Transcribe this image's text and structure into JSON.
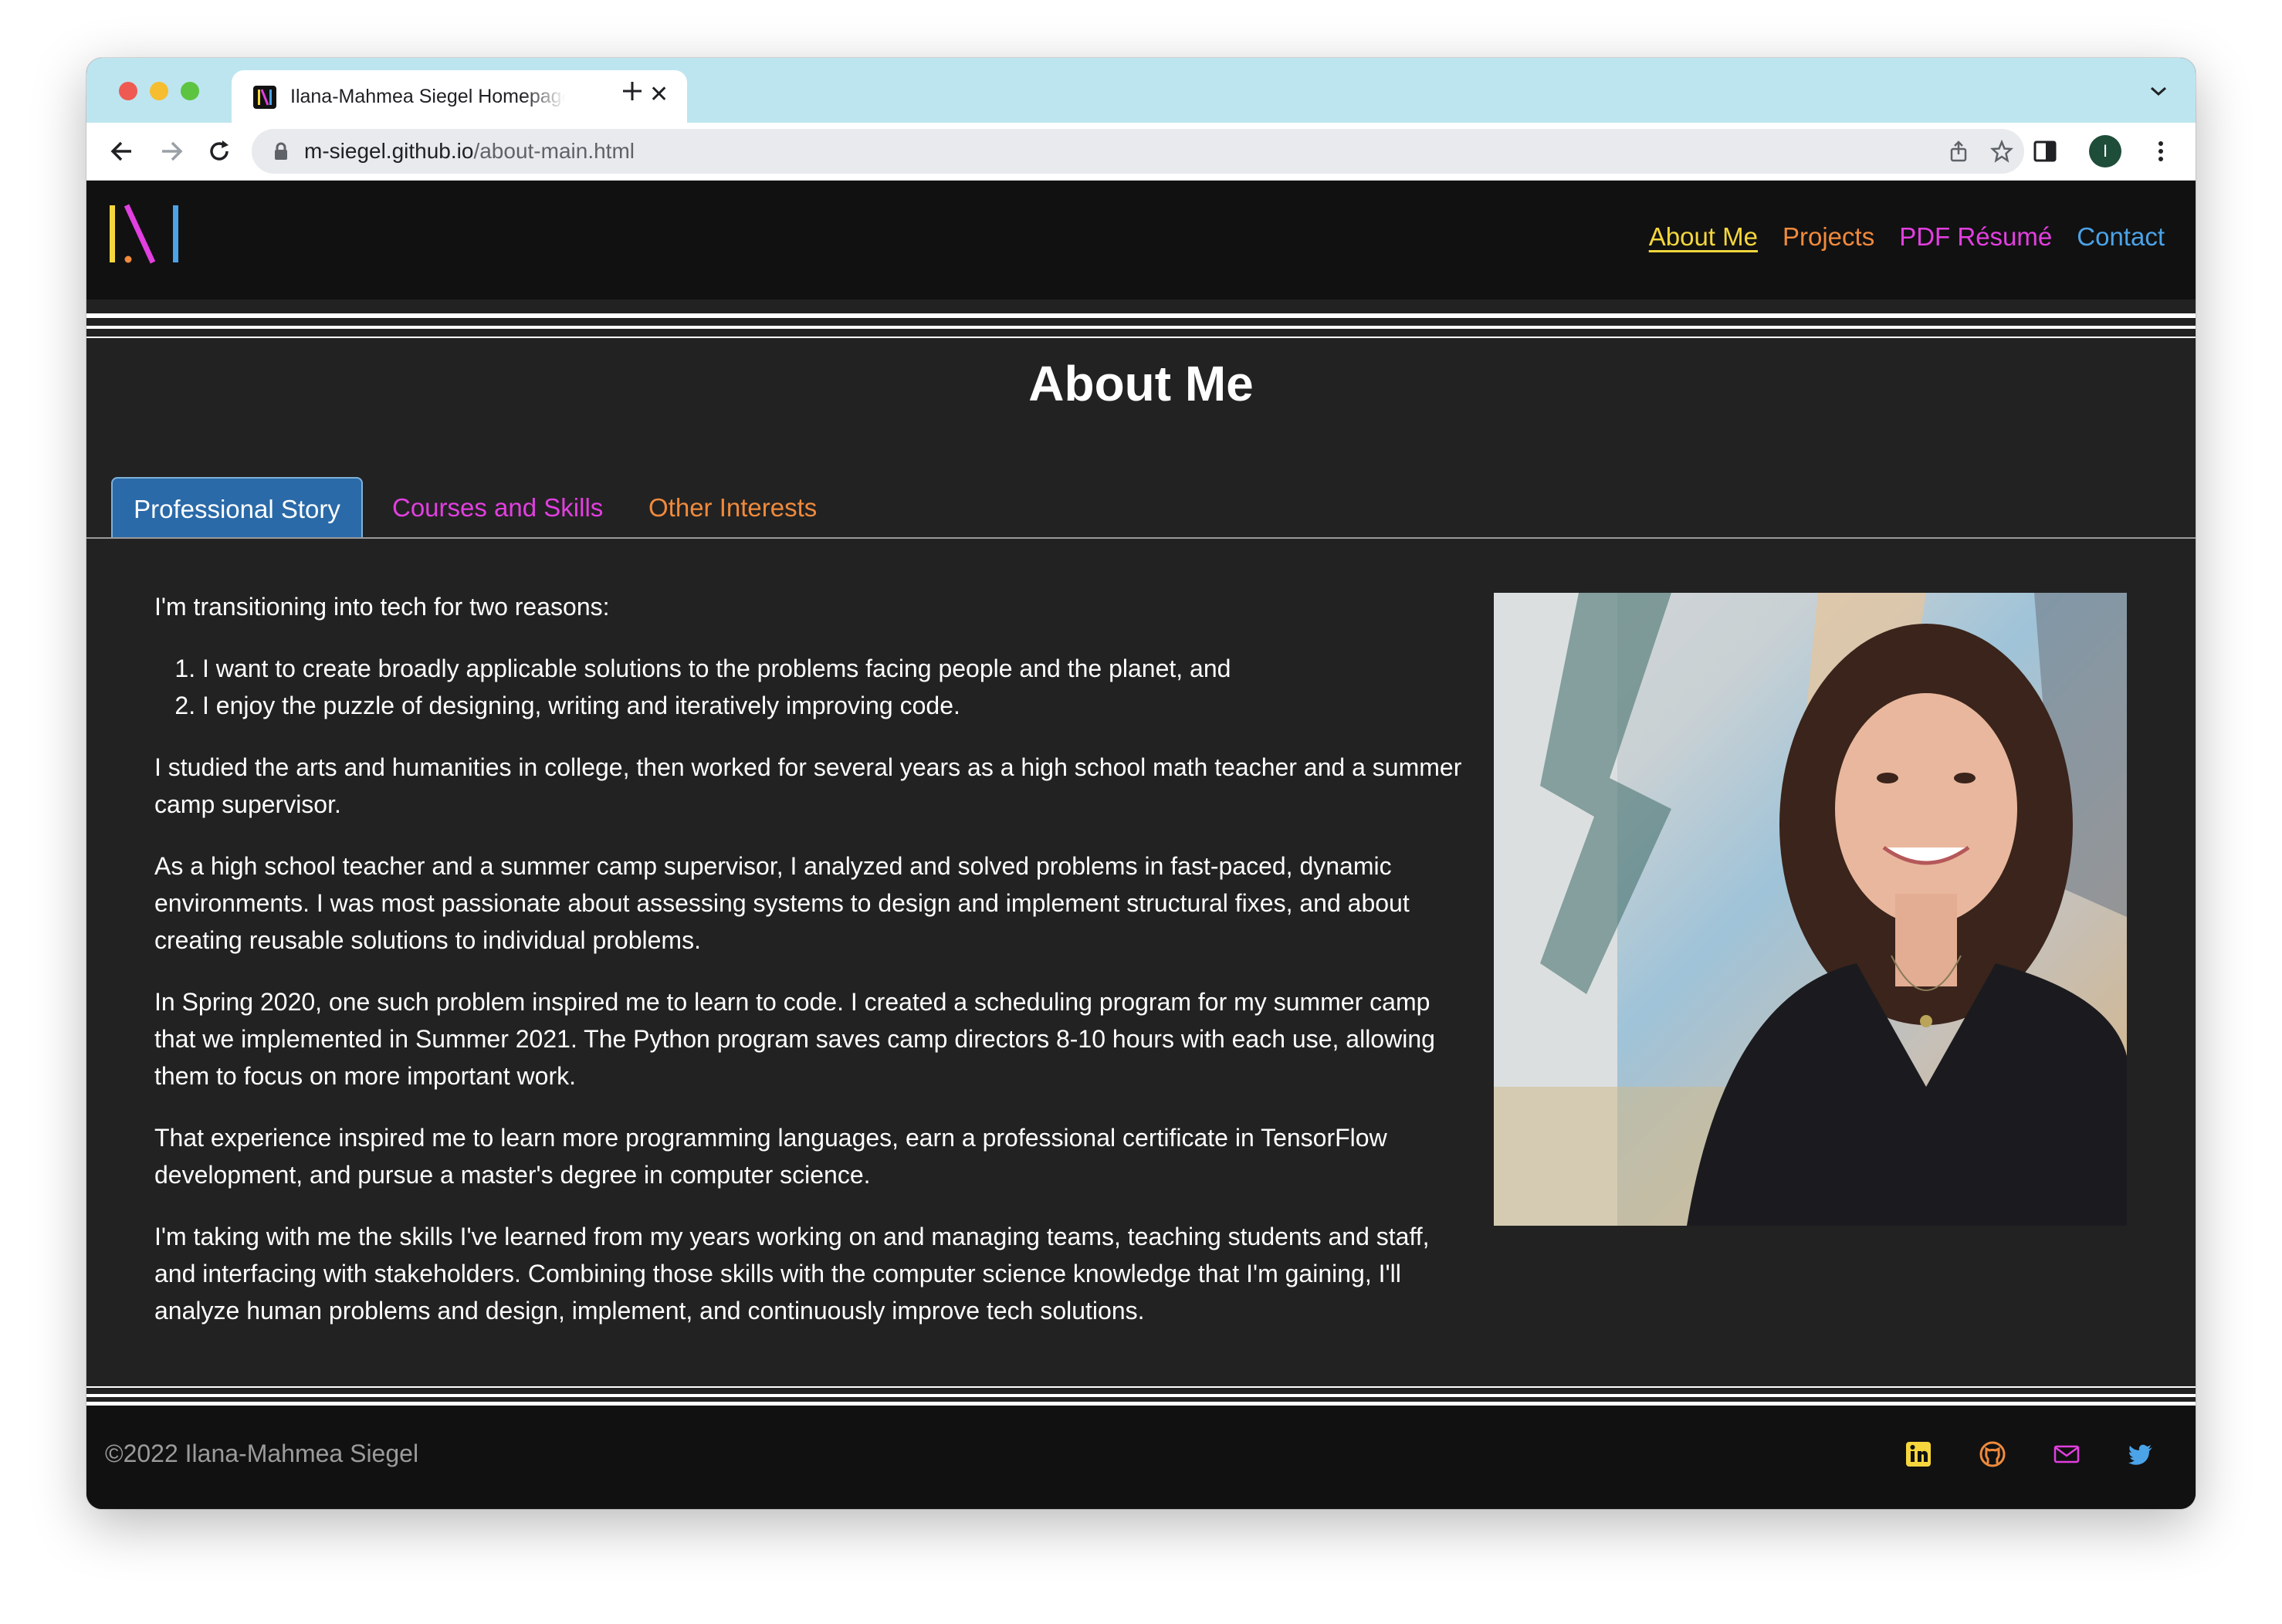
{
  "browser": {
    "tab_title": "Ilana-Mahmea Siegel Homepage",
    "tab_close": "✕",
    "url_host": "m-siegel.github.io",
    "url_path": "/about-main.html",
    "avatar_initial": "I"
  },
  "header": {
    "nav": [
      {
        "label": "About Me",
        "color": "#f5d63d",
        "active": true
      },
      {
        "label": "Projects",
        "color": "#f08a3c",
        "active": false
      },
      {
        "label": "PDF Résumé",
        "color": "#e23fe0",
        "active": false
      },
      {
        "label": "Contact",
        "color": "#4ba3e8",
        "active": false
      }
    ],
    "logo_colors": [
      "#f5d63d",
      "#e23fe0",
      "#f08a3c",
      "#4ba3e8"
    ]
  },
  "main": {
    "title": "About Me",
    "tabs": [
      {
        "label": "Professional Story",
        "active": true
      },
      {
        "label": "Courses and Skills",
        "color": "#e23fe0"
      },
      {
        "label": "Other Interests",
        "color": "#f08a3c"
      }
    ],
    "intro": "I'm transitioning into tech for two reasons:",
    "reasons": [
      "I want to create broadly applicable solutions to the problems facing people and the planet, and",
      "I enjoy the puzzle of designing, writing and iteratively improving code."
    ],
    "paragraphs": [
      "I studied the arts and humanities in college, then worked for several years as a high school math teacher and a summer camp supervisor.",
      "As a high school teacher and a summer camp supervisor, I analyzed and solved problems in fast-paced, dynamic environments. I was most passionate about assessing systems to design and implement structural fixes, and about creating reusable solutions to individual problems.",
      "In Spring 2020, one such problem inspired me to learn to code. I created a scheduling program for my summer camp that we implemented in Summer 2021. The Python program saves camp directors 8-10 hours with each use, allowing them to focus on more important work.",
      "That experience inspired me to learn more programming languages, earn a professional certificate in TensorFlow development, and pursue a master's degree in computer science.",
      "I'm taking with me the skills I've learned from my years working on and managing teams, teaching students and staff, and interfacing with stakeholders. Combining those skills with the computer science knowledge that I'm gaining, I'll analyze human problems and design, implement, and continuously improve tech solutions."
    ]
  },
  "footer": {
    "copyright": "©2022 Ilana-Mahmea Siegel",
    "social": [
      {
        "icon": "linkedin-icon",
        "color": "#f5d63d"
      },
      {
        "icon": "github-icon",
        "color": "#f08a3c"
      },
      {
        "icon": "mail-icon",
        "color": "#e23fe0"
      },
      {
        "icon": "twitter-icon",
        "color": "#4ba3e8"
      }
    ]
  }
}
